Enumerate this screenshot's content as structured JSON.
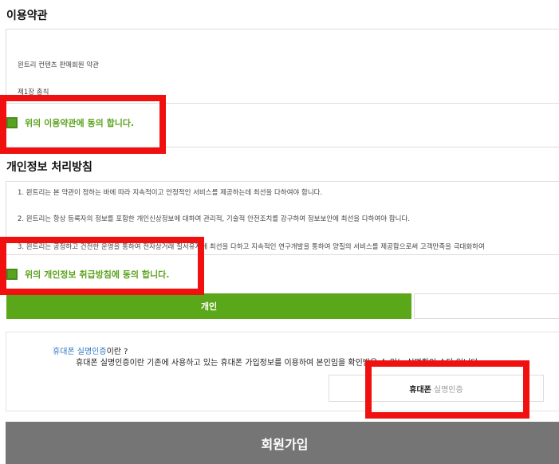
{
  "terms": {
    "title": "이용약관",
    "lines": [
      "윈트리 컨텐츠 판매회원 약관",
      "제1장 총칙"
    ],
    "agree_label": "위의 이용약관에 동의 합니다."
  },
  "privacy": {
    "title": "개인정보 처리방침",
    "lines": [
      "1. 윈트리는 본 약관이 정하는 바에 따라 지속적이고 안정적인 서비스를 제공하는데 최선을 다하여야 합니다.",
      "2. 윈트리는 항상 등록자의 정보를 포함한 개인신상정보에 대하여 관리적, 기술적 안전조치를 강구하여 정보보안에 최선을 다하여야 합니다.",
      "3. 윈트리는 공정하고 건전한 운영을 통하여 전자상거래 질서유지에 최선을 다하고 지속적인 연구개발을 통하여 양질의 서비스를 제공함으로써 고객만족을 극대화하여"
    ],
    "agree_label": "위의 개인정보 취급방침에 동의 합니다."
  },
  "member_tabs": {
    "personal": "개인"
  },
  "phone_auth": {
    "question_highlight": "휴대폰 실명인증",
    "question_rest": "이란 ?",
    "description": "휴대폰 실명인증이란 기존에 사용하고 있는 휴대폰 가입정보를 이용하여 본인임을 확인받을 수 있는 실명확인 수단 입니다.",
    "button_dark": "휴대폰",
    "button_light": "실명인증"
  },
  "signup_button": "회원가입",
  "colors": {
    "accent_green": "#5aa81a",
    "link_blue": "#2f78c4",
    "highlight_red": "#f01010",
    "signup_gray": "#757575"
  }
}
